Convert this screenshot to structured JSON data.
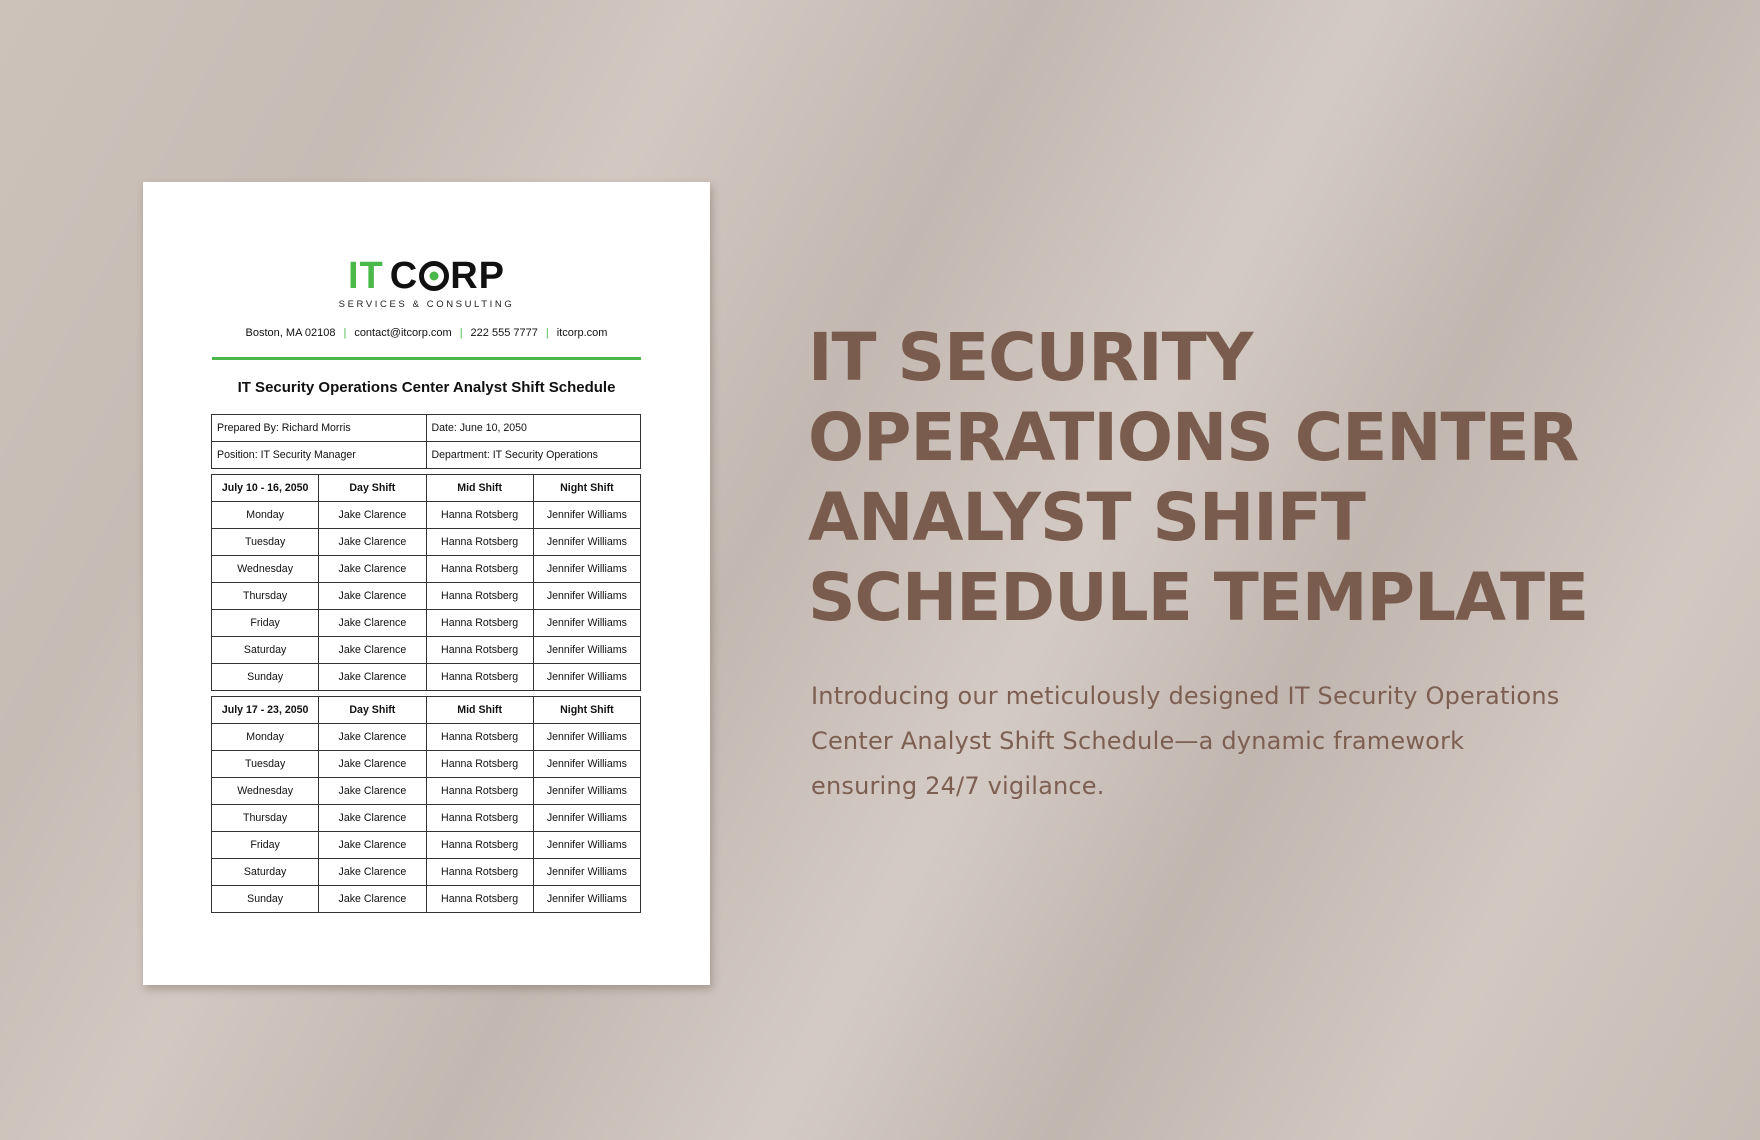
{
  "document": {
    "logo": {
      "it": "IT",
      "corp_c": "C",
      "corp_rp": "RP",
      "tagline": "SERVICES & CONSULTING",
      "brand_color": "#4bb84a"
    },
    "contact": [
      "Boston, MA 02108",
      "contact@itcorp.com",
      "222 555 7777",
      "itcorp.com"
    ],
    "contact_separator": "|",
    "title": "IT Security Operations Center Analyst Shift Schedule",
    "info": {
      "prepared_by": "Prepared By: Richard Morris",
      "date": "Date: June 10, 2050",
      "position": "Position: IT Security Manager",
      "department": "Department: IT Security Operations"
    },
    "schedules": [
      {
        "headers": [
          "July 10 - 16, 2050",
          "Day Shift",
          "Mid Shift",
          "Night Shift"
        ],
        "rows": [
          [
            "Monday",
            "Jake Clarence",
            "Hanna Rotsberg",
            "Jennifer Williams"
          ],
          [
            "Tuesday",
            "Jake Clarence",
            "Hanna Rotsberg",
            "Jennifer Williams"
          ],
          [
            "Wednesday",
            "Jake Clarence",
            "Hanna Rotsberg",
            "Jennifer Williams"
          ],
          [
            "Thursday",
            "Jake Clarence",
            "Hanna Rotsberg",
            "Jennifer Williams"
          ],
          [
            "Friday",
            "Jake Clarence",
            "Hanna Rotsberg",
            "Jennifer Williams"
          ],
          [
            "Saturday",
            "Jake Clarence",
            "Hanna Rotsberg",
            "Jennifer Williams"
          ],
          [
            "Sunday",
            "Jake Clarence",
            "Hanna Rotsberg",
            "Jennifer Williams"
          ]
        ]
      },
      {
        "headers": [
          "July 17 - 23, 2050",
          "Day Shift",
          "Mid Shift",
          "Night Shift"
        ],
        "rows": [
          [
            "Monday",
            "Jake Clarence",
            "Hanna Rotsberg",
            "Jennifer Williams"
          ],
          [
            "Tuesday",
            "Jake Clarence",
            "Hanna Rotsberg",
            "Jennifer Williams"
          ],
          [
            "Wednesday",
            "Jake Clarence",
            "Hanna Rotsberg",
            "Jennifer Williams"
          ],
          [
            "Thursday",
            "Jake Clarence",
            "Hanna Rotsberg",
            "Jennifer Williams"
          ],
          [
            "Friday",
            "Jake Clarence",
            "Hanna Rotsberg",
            "Jennifer Williams"
          ],
          [
            "Saturday",
            "Jake Clarence",
            "Hanna Rotsberg",
            "Jennifer Williams"
          ],
          [
            "Sunday",
            "Jake Clarence",
            "Hanna Rotsberg",
            "Jennifer Williams"
          ]
        ]
      }
    ]
  },
  "promo": {
    "heading_lines": [
      "IT SECURITY",
      "OPERATIONS CENTER",
      "ANALYST SHIFT",
      "SCHEDULE TEMPLATE"
    ],
    "body": "Introducing our meticulously designed IT Security Operations Center Analyst Shift Schedule—a dynamic framework ensuring 24/7 vigilance.",
    "text_color": "#7a5c4e"
  }
}
